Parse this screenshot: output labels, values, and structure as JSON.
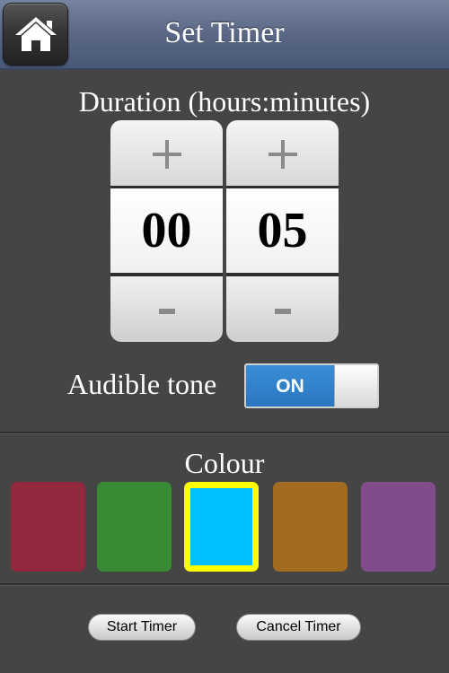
{
  "header": {
    "title": "Set Timer",
    "home_icon": "home-icon"
  },
  "duration": {
    "label": "Duration (hours:minutes)",
    "hours": "00",
    "minutes": "05",
    "increment_icon": "plus-icon",
    "decrement_icon": "minus-icon"
  },
  "audible_tone": {
    "label": "Audible tone",
    "state": "ON"
  },
  "colour": {
    "label": "Colour",
    "swatches": [
      {
        "color": "#92283d",
        "selected": false
      },
      {
        "color": "#398a35",
        "selected": false
      },
      {
        "color": "#00bfff",
        "selected": true
      },
      {
        "color": "#a26b22",
        "selected": false
      },
      {
        "color": "#814b8c",
        "selected": false
      }
    ]
  },
  "actions": {
    "start_label": "Start Timer",
    "cancel_label": "Cancel Timer"
  }
}
